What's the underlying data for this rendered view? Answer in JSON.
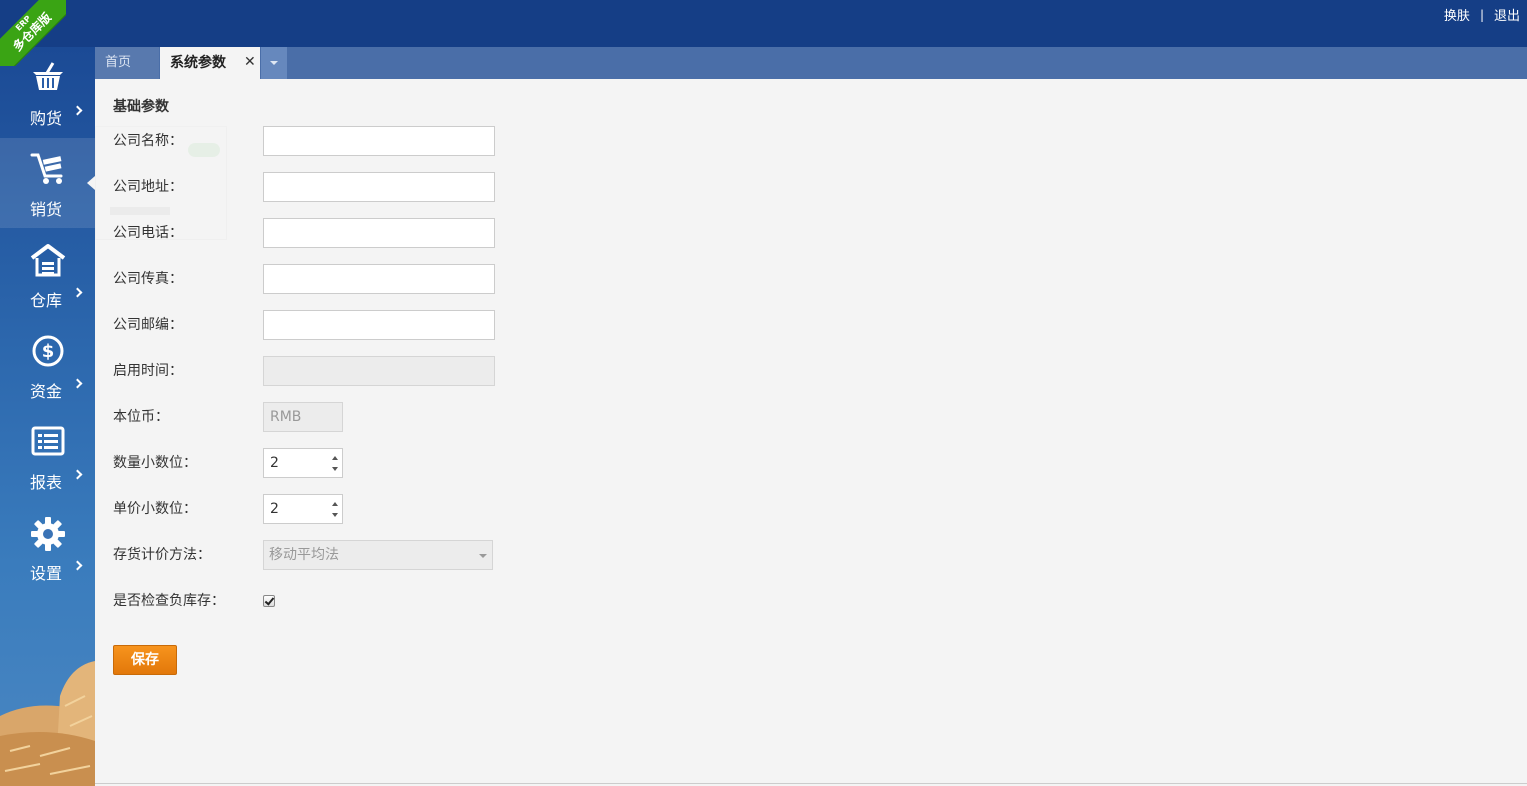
{
  "brand": {
    "ribbon_small": "ERP",
    "ribbon_main": "多仓库版",
    "ribbon_color": "#3aa414"
  },
  "header": {
    "skin_link": "换肤",
    "separator": "|",
    "logout_link": "退出",
    "bg_color": "#153e86"
  },
  "sidebar": {
    "items": [
      {
        "label": "购货",
        "icon": "basket-icon"
      },
      {
        "label": "销货",
        "icon": "cart-icon",
        "active": true
      },
      {
        "label": "仓库",
        "icon": "warehouse-icon"
      },
      {
        "label": "资金",
        "icon": "dollar-icon"
      },
      {
        "label": "报表",
        "icon": "report-icon"
      },
      {
        "label": "设置",
        "icon": "gear-icon"
      }
    ]
  },
  "tabs": {
    "home": "首页",
    "system": "系统参数",
    "close": "✕"
  },
  "form": {
    "section_title": "基础参数",
    "company_name": {
      "label": "公司名称：",
      "value": ""
    },
    "company_address": {
      "label": "公司地址：",
      "value": ""
    },
    "company_phone": {
      "label": "公司电话：",
      "value": ""
    },
    "company_fax": {
      "label": "公司传真：",
      "value": ""
    },
    "company_postcode": {
      "label": "公司邮编：",
      "value": ""
    },
    "start_date": {
      "label": "启用时间：",
      "value": ""
    },
    "base_currency": {
      "label": "本位币：",
      "value": "RMB"
    },
    "qty_decimals": {
      "label": "数量小数位：",
      "value": "2"
    },
    "price_decimals": {
      "label": "单价小数位：",
      "value": "2"
    },
    "costing_method": {
      "label": "存货计价方法：",
      "value": "移动平均法"
    },
    "check_negative_stock": {
      "label": "是否检查负库存：",
      "checked": true
    },
    "save_label": "保存",
    "save_color": "#f08a17"
  }
}
